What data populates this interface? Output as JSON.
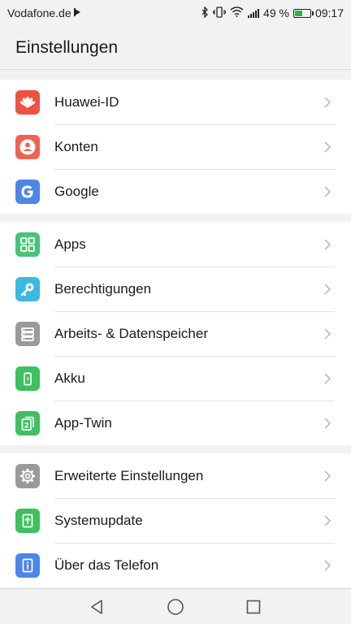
{
  "status_bar": {
    "carrier": "Vodafone.de",
    "battery_percent": "49 %",
    "battery_level": 0.49,
    "time": "09:17",
    "battery_color": "#2db34a"
  },
  "app_bar": {
    "title": "Einstellungen"
  },
  "groups": [
    {
      "items": [
        {
          "label": "Huawei-ID",
          "icon": "huawei-logo-icon",
          "color": "#ec5244"
        },
        {
          "label": "Konten",
          "icon": "account-icon",
          "color": "#ef6352"
        },
        {
          "label": "Google",
          "icon": "google-icon",
          "color": "#4c86e8"
        }
      ]
    },
    {
      "items": [
        {
          "label": "Apps",
          "icon": "apps-grid-icon",
          "color": "#47c475"
        },
        {
          "label": "Berechtigungen",
          "icon": "key-icon",
          "color": "#3db8e0"
        },
        {
          "label": "Arbeits- & Datenspeicher",
          "icon": "storage-icon",
          "color": "#9a9a9a"
        },
        {
          "label": "Akku",
          "icon": "battery-icon",
          "color": "#3ec060"
        },
        {
          "label": "App-Twin",
          "icon": "app-twin-icon",
          "color": "#3ec060"
        }
      ]
    },
    {
      "items": [
        {
          "label": "Erweiterte Einstellungen",
          "icon": "gear-icon",
          "color": "#9a9a9a"
        },
        {
          "label": "Systemupdate",
          "icon": "system-update-icon",
          "color": "#3ec060"
        },
        {
          "label": "Über das Telefon",
          "icon": "info-icon",
          "color": "#4c86e8"
        }
      ]
    }
  ],
  "nav_bar": {
    "back": "back-triangle-icon",
    "home": "home-circle-icon",
    "recents": "recents-square-icon"
  }
}
